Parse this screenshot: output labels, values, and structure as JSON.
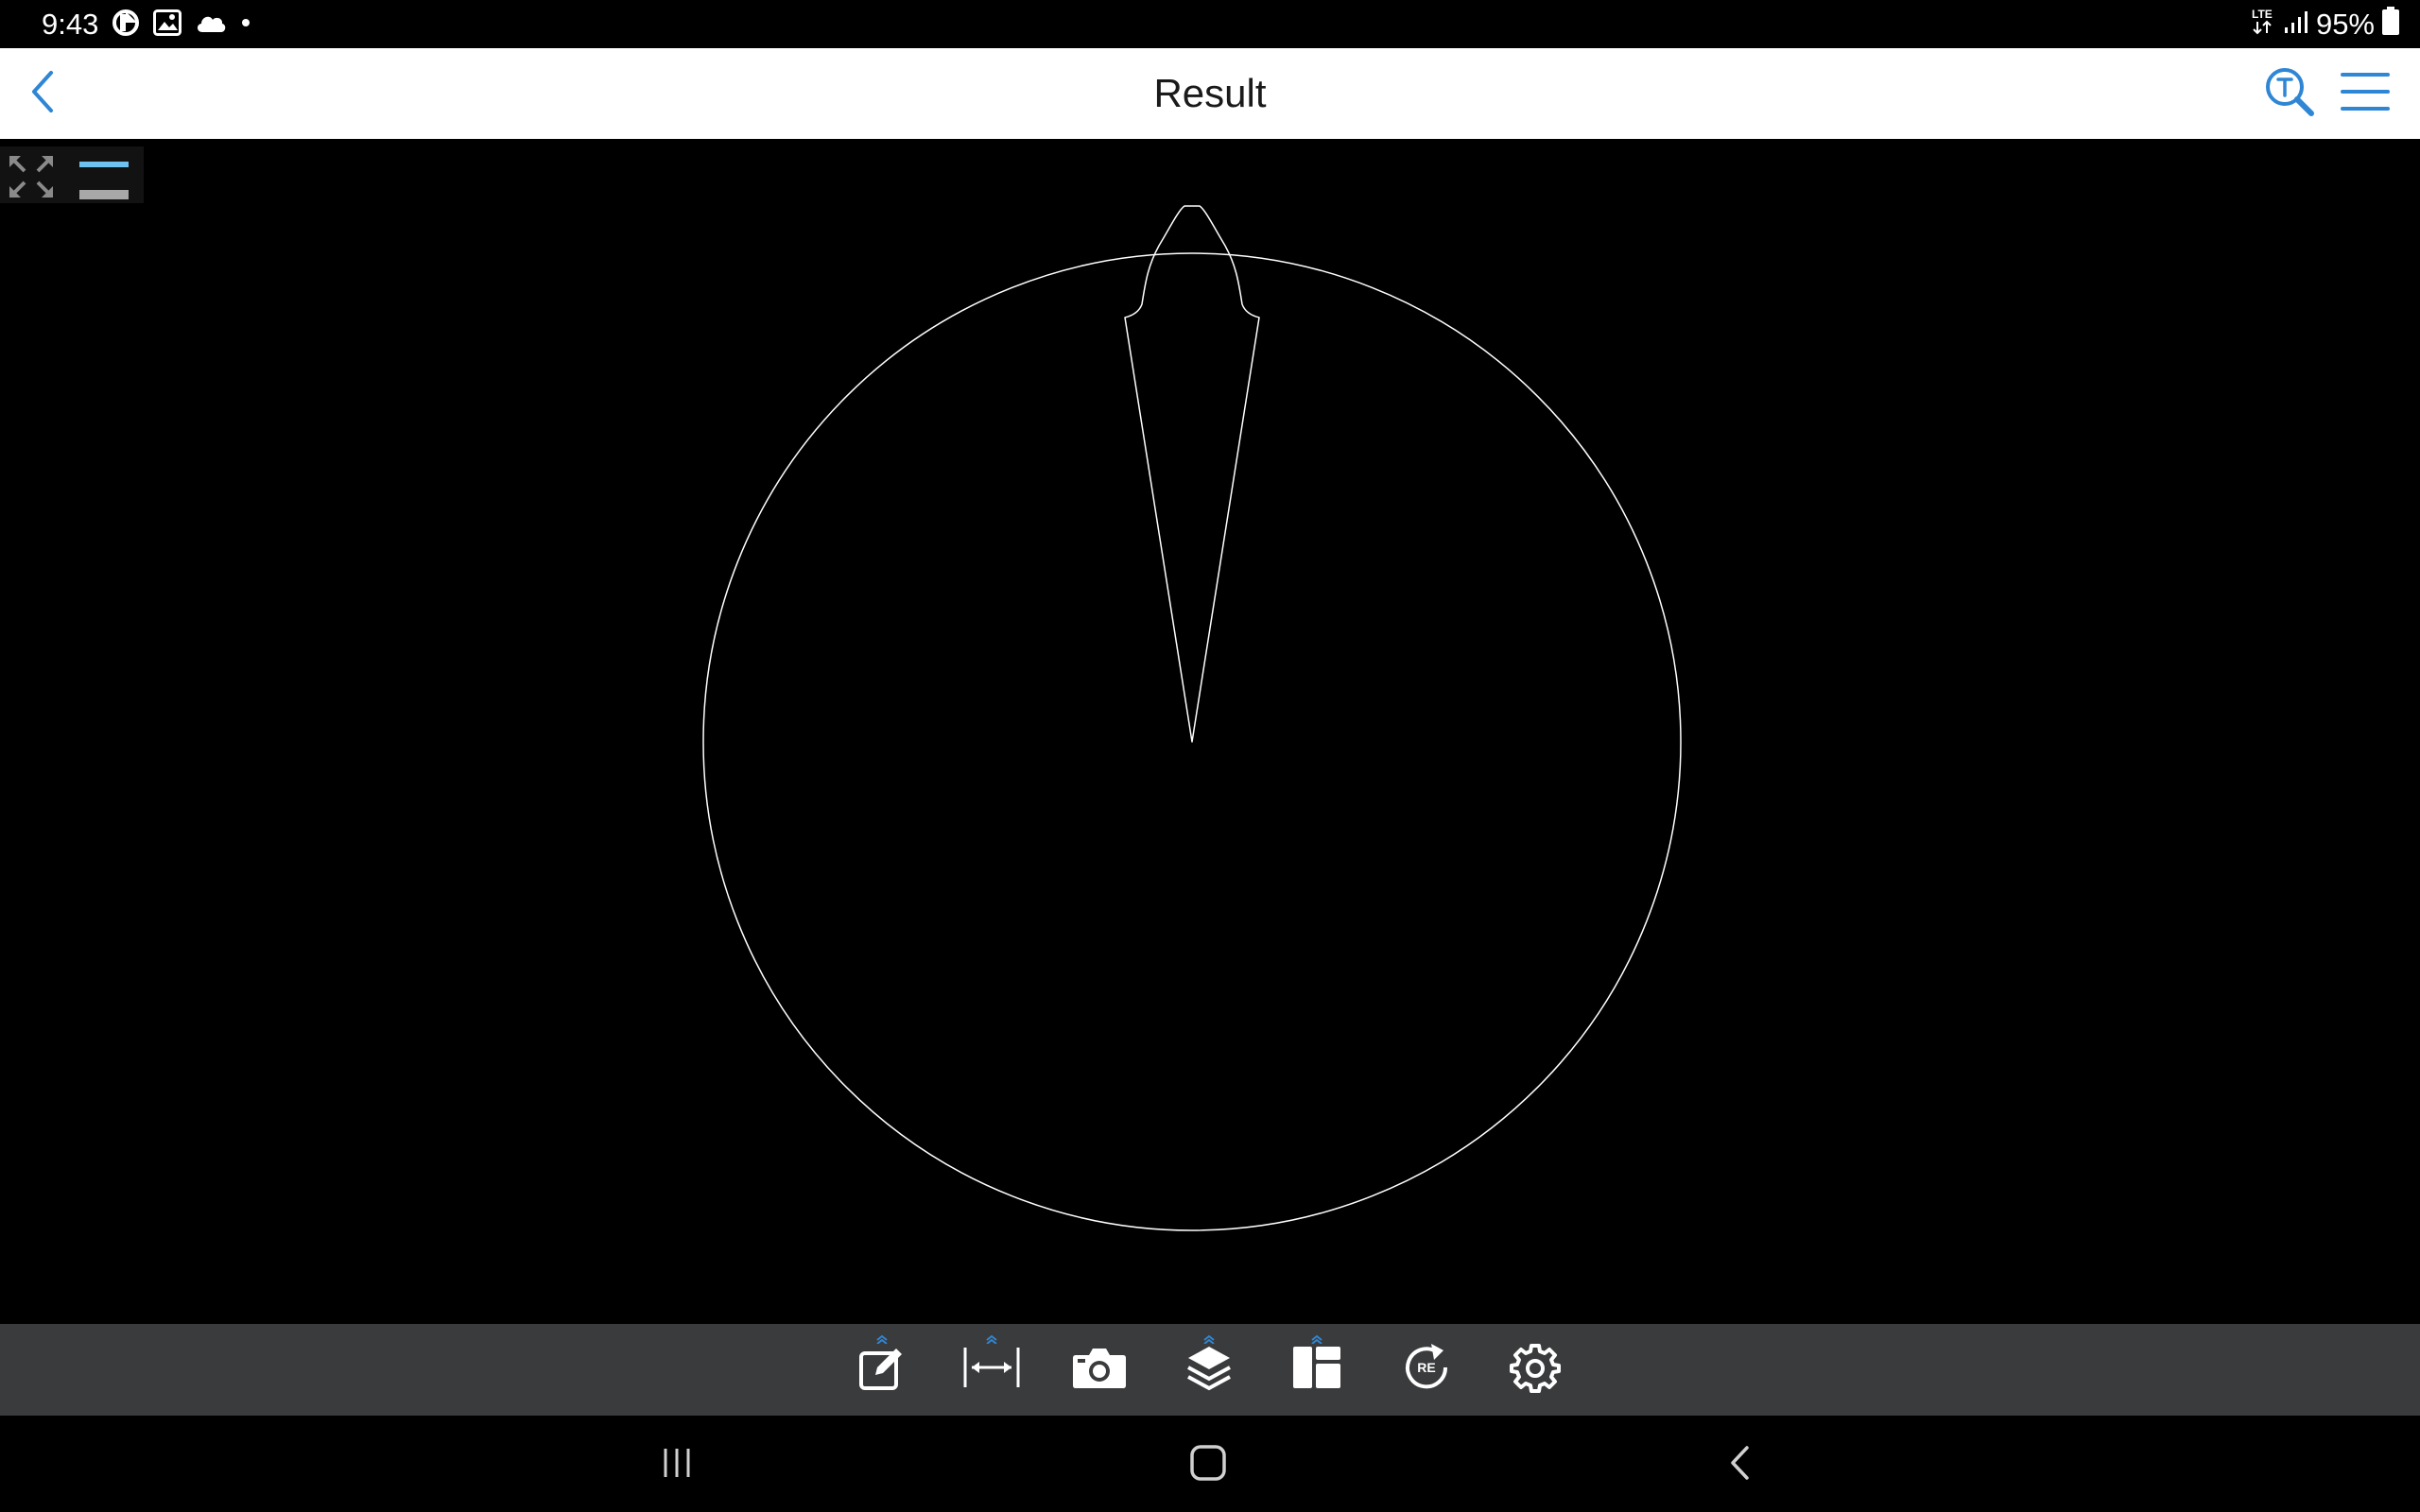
{
  "status_bar": {
    "time": "9:43",
    "battery": "95%",
    "network": "LTE",
    "icons": [
      "app-notification-icon",
      "gallery-icon",
      "cloud-icon",
      "dot-icon",
      "lte-icon",
      "signal-icon",
      "battery-icon"
    ]
  },
  "app_bar": {
    "title": "Result",
    "icons": [
      "back-icon",
      "text-search-icon",
      "menu-icon"
    ]
  },
  "toolbar": {
    "items": [
      {
        "icon": "edit-icon",
        "has_expand": true
      },
      {
        "icon": "measure-icon",
        "has_expand": true
      },
      {
        "icon": "camera-icon",
        "has_expand": false
      },
      {
        "icon": "layers-icon",
        "has_expand": true
      },
      {
        "icon": "layout-icon",
        "has_expand": true
      },
      {
        "icon": "regen-icon",
        "label": "RE",
        "has_expand": false
      },
      {
        "icon": "settings-icon",
        "has_expand": false
      }
    ]
  },
  "colors": {
    "accent": "#2f86d4",
    "canvas_bg": "#000000",
    "drawing_stroke": "#ffffff",
    "toolbar_bg": "#3a3b3c"
  }
}
